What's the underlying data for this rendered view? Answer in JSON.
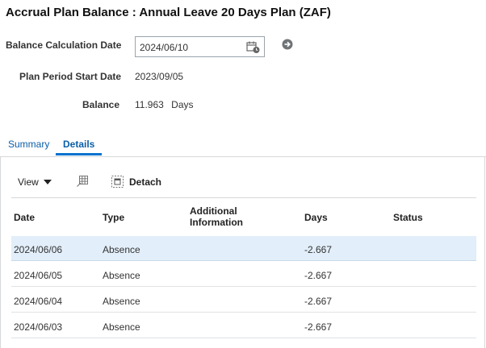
{
  "page": {
    "title": "Accrual Plan Balance : Annual Leave 20 Days Plan (ZAF)"
  },
  "form": {
    "balance_calculation_date": {
      "label": "Balance Calculation Date",
      "value": "2024/06/10"
    },
    "plan_period_start_date": {
      "label": "Plan Period Start Date",
      "value": "2023/09/05"
    },
    "balance": {
      "label": "Balance",
      "value": "11.963",
      "unit": "Days"
    }
  },
  "tabs": [
    {
      "label": "Summary",
      "selected": false
    },
    {
      "label": "Details",
      "selected": true
    }
  ],
  "toolbar": {
    "view_label": "View",
    "detach_label": "Detach"
  },
  "table": {
    "columns": [
      "Date",
      "Type",
      "Additional Information",
      "Days",
      "Status"
    ],
    "rows": [
      {
        "date": "2024/06/06",
        "type": "Absence",
        "info": "",
        "days": "-2.667",
        "status": ""
      },
      {
        "date": "2024/06/05",
        "type": "Absence",
        "info": "",
        "days": "-2.667",
        "status": ""
      },
      {
        "date": "2024/06/04",
        "type": "Absence",
        "info": "",
        "days": "-2.667",
        "status": ""
      },
      {
        "date": "2024/06/03",
        "type": "Absence",
        "info": "",
        "days": "-2.667",
        "status": ""
      }
    ]
  },
  "icons": {
    "calendar": "calendar-icon",
    "go": "go-arrow-icon",
    "freeze": "freeze-columns-icon",
    "detach": "detach-icon"
  },
  "colors": {
    "link": "#0b5ea8",
    "tab_underline": "#0572ce",
    "selected_row": "#e2eef9"
  }
}
